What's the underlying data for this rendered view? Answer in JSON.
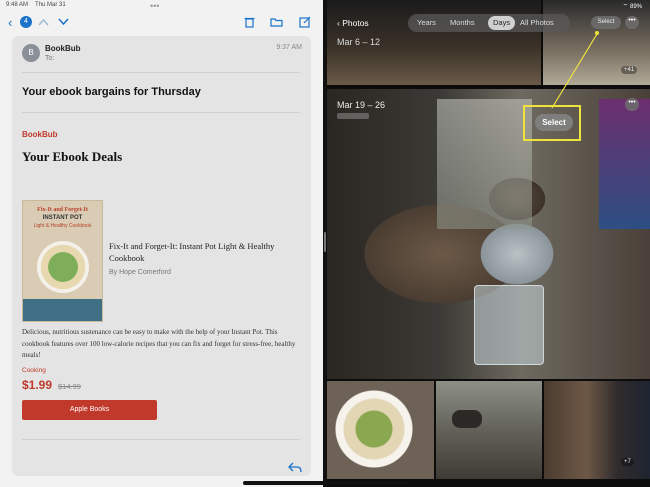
{
  "status_bar": {
    "time": "9:48 AM",
    "date": "Thu Mar 31",
    "right": "⌔ 89%"
  },
  "mail": {
    "toolbar": {
      "back_icon": "chevron-left-icon",
      "badge": "4",
      "up_icon": "chevron-up-icon",
      "down_icon": "chevron-down-icon",
      "trash_icon": "trash-icon",
      "folder_icon": "folder-icon",
      "compose_icon": "compose-icon",
      "multitask_dots": "•••"
    },
    "message": {
      "avatar_initial": "B",
      "sender": "BookBub",
      "to": "To:",
      "time": "9:37 AM",
      "subject": "Your ebook bargains for Thursday",
      "brand": "BookBub",
      "heading": "Your Ebook Deals",
      "book": {
        "cover_line1": "Fix-It and Forget-It",
        "cover_line2": "INSTANT POT",
        "cover_line3": "Light & Healthy Cookbook",
        "title": "Fix-It and Forget-It: Instant Pot Light & Healthy Cookbook",
        "author": "By Hope Comerford",
        "description": "Delicious, nutritious sustenance can be easy to make with the help of your Instant Pot. This cookbook features over 100 low-calorie recipes that you can fix and forget for stress-free, healthy meals!",
        "category": "Cooking",
        "price": "$1.99",
        "old_price": "$14.99",
        "buy_label": "Apple Books"
      }
    },
    "reply_icon": "reply-icon"
  },
  "photos": {
    "back_label": "Photos",
    "segments": [
      "Years",
      "Months",
      "Days",
      "All Photos"
    ],
    "active_segment": "Days",
    "select_small": "Select",
    "more": "•••",
    "date_top": "Mar 6 – 12",
    "count_top": "+41",
    "date_main": "Mar 19 – 26",
    "select_big": "Select",
    "count_bottom": "+7",
    "highlight_color": "#f0e43a"
  }
}
